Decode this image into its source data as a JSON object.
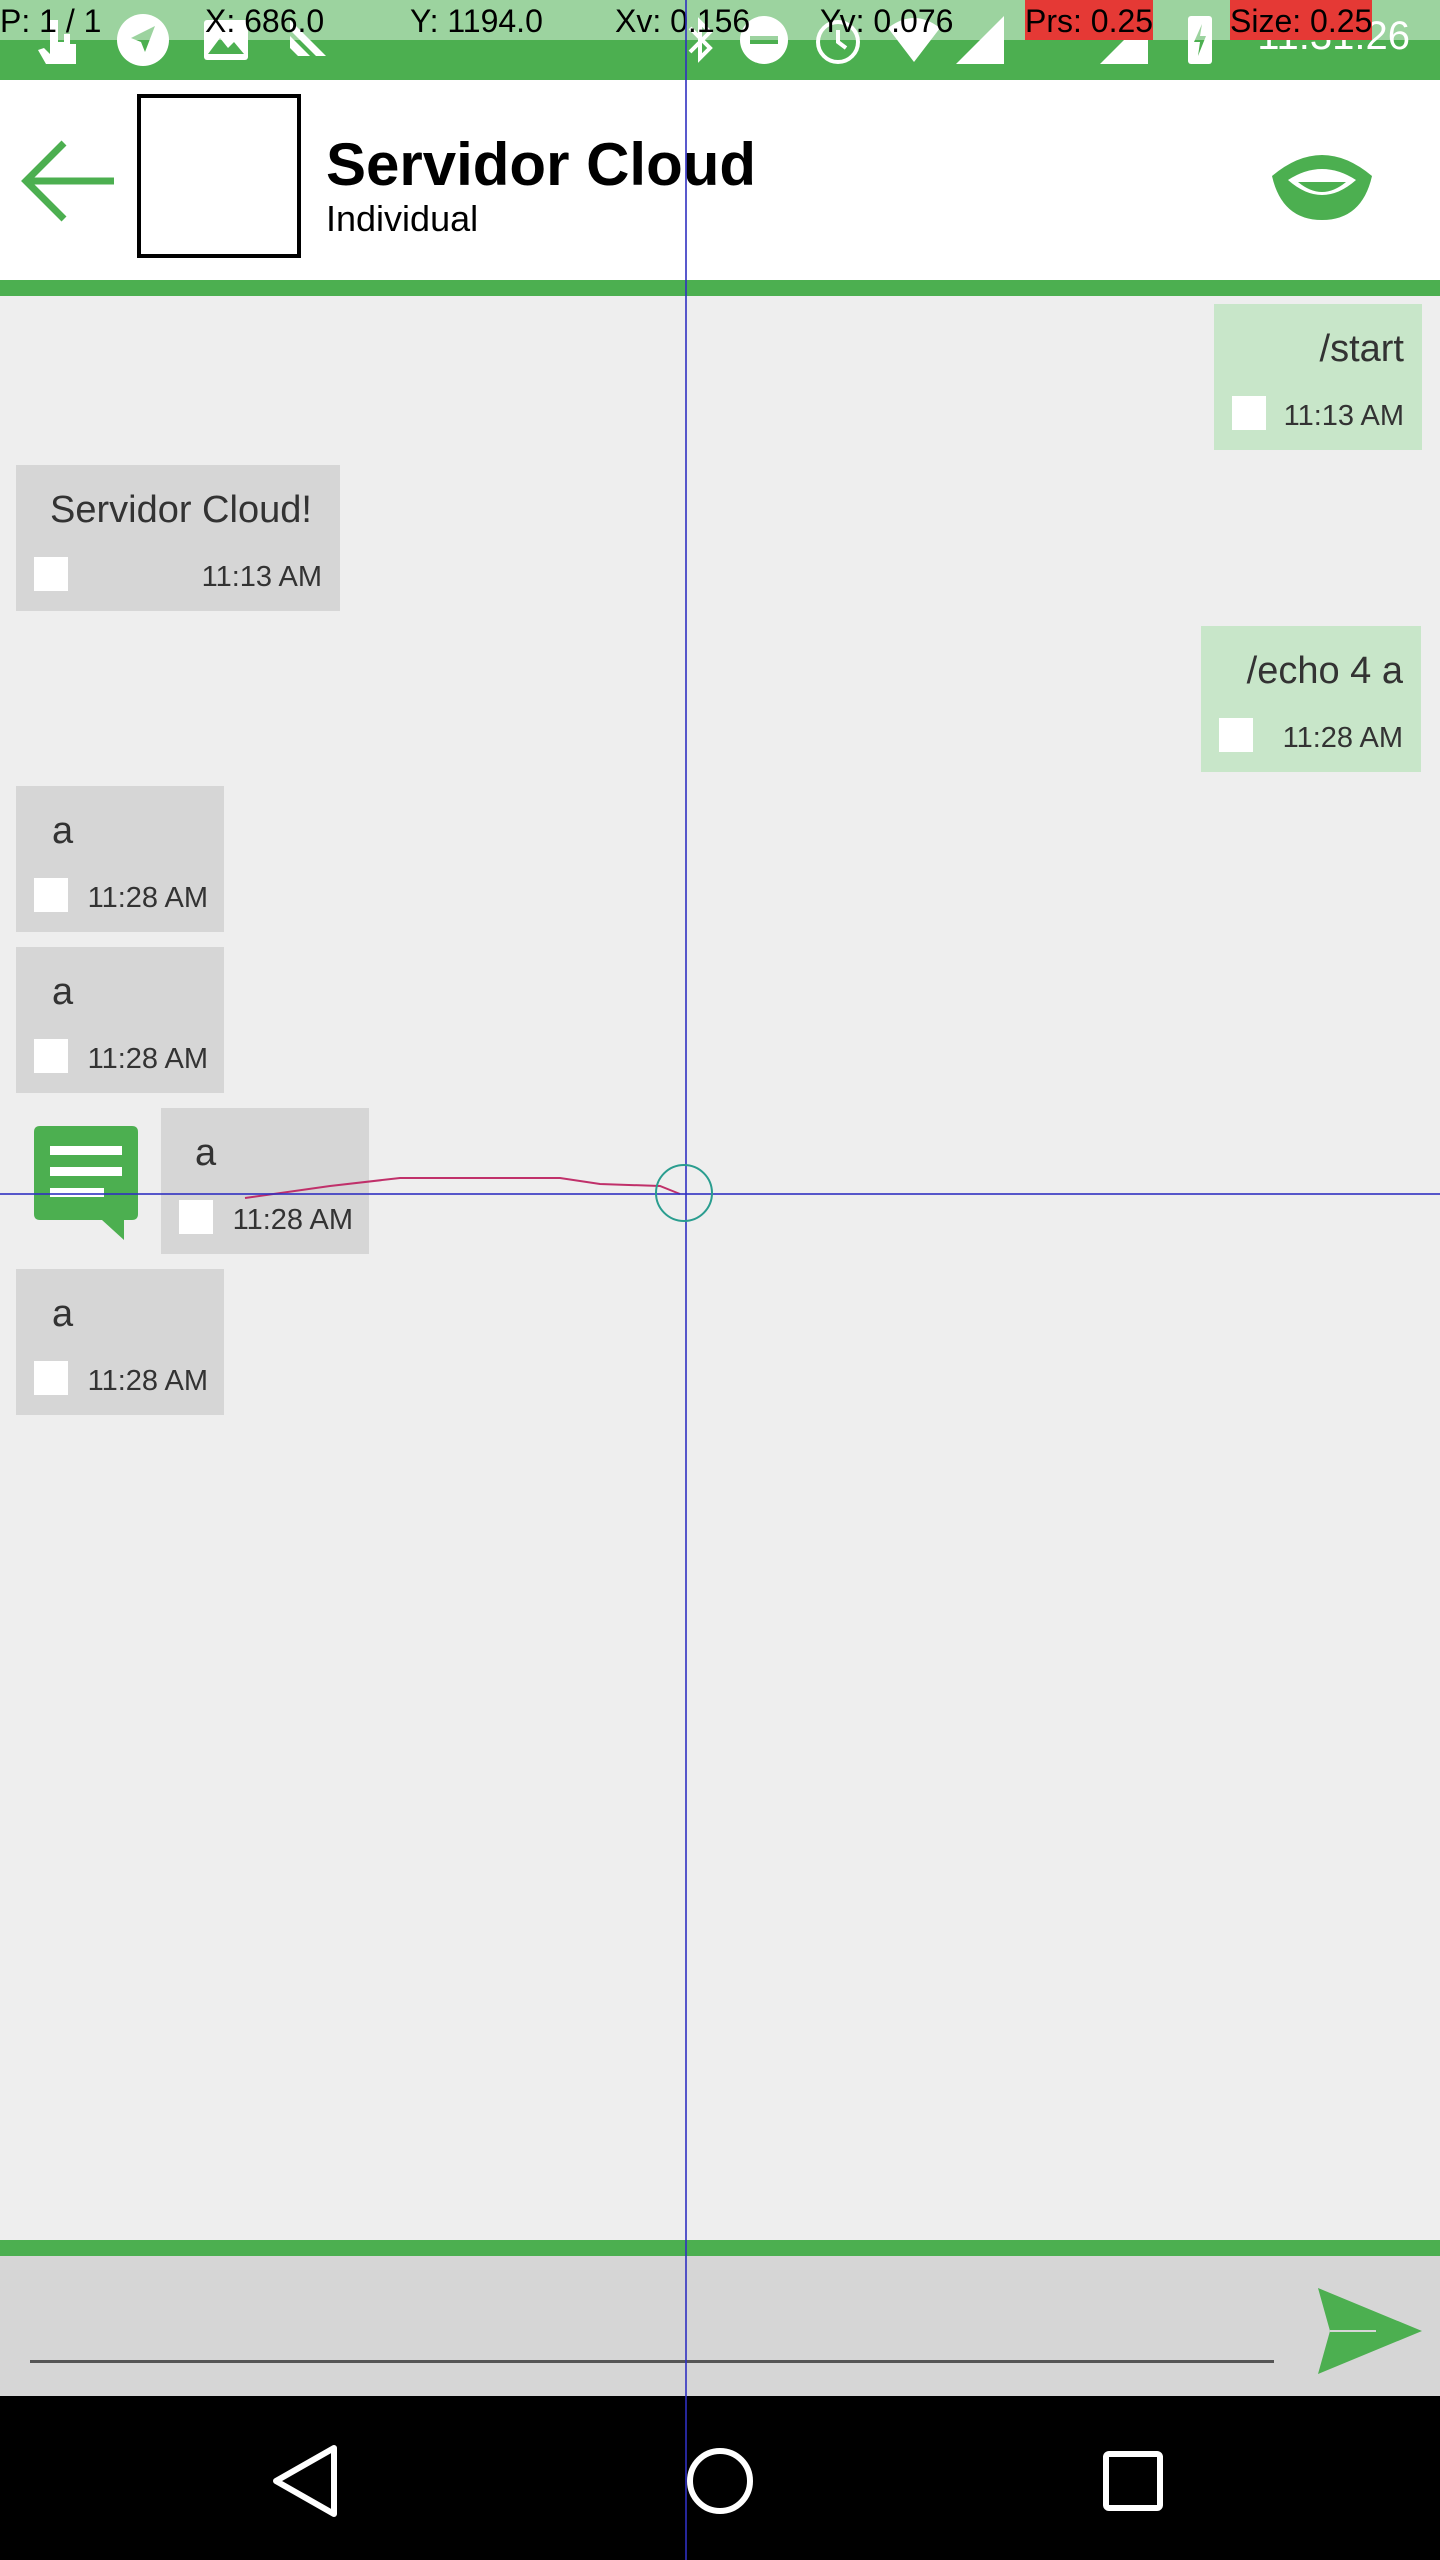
{
  "status_bar": {
    "time": "11:31:26",
    "icons": [
      "touch-icon",
      "navigation-icon",
      "image-icon",
      "cast-icon",
      "bluetooth-icon",
      "do-not-disturb-icon",
      "alarm-icon",
      "wifi-icon",
      "signal-icon",
      "signal-icon",
      "battery-charging-icon"
    ]
  },
  "pointer_overlay": {
    "p": "P: 1 / 1",
    "x": "X: 686.0",
    "y": "Y: 1194.0",
    "xv": "Xv: 0.156",
    "yv": "Yv: 0.076",
    "prs": "Prs: 0.25",
    "size": "Size: 0.25"
  },
  "toolbar": {
    "title": "Servidor Cloud",
    "subtitle": "Individual"
  },
  "messages": [
    {
      "dir": "out",
      "text": "/start",
      "time": "11:13 AM"
    },
    {
      "dir": "in",
      "text": "Servidor Cloud!",
      "time": "11:13 AM"
    },
    {
      "dir": "out",
      "text": "/echo 4 a",
      "time": "11:28 AM"
    },
    {
      "dir": "in",
      "text": "a",
      "time": "11:28 AM"
    },
    {
      "dir": "in",
      "text": "a",
      "time": "11:28 AM"
    },
    {
      "dir": "in",
      "text": "a",
      "time": "11:28 AM"
    },
    {
      "dir": "in",
      "text": "a",
      "time": "11:28 AM"
    }
  ],
  "input": {
    "value": "",
    "placeholder": ""
  },
  "colors": {
    "accent": "#4caf50",
    "outgoing_bubble": "#c8e6c9",
    "incoming_bubble": "#d6d6d6",
    "background": "#eeeeee"
  }
}
